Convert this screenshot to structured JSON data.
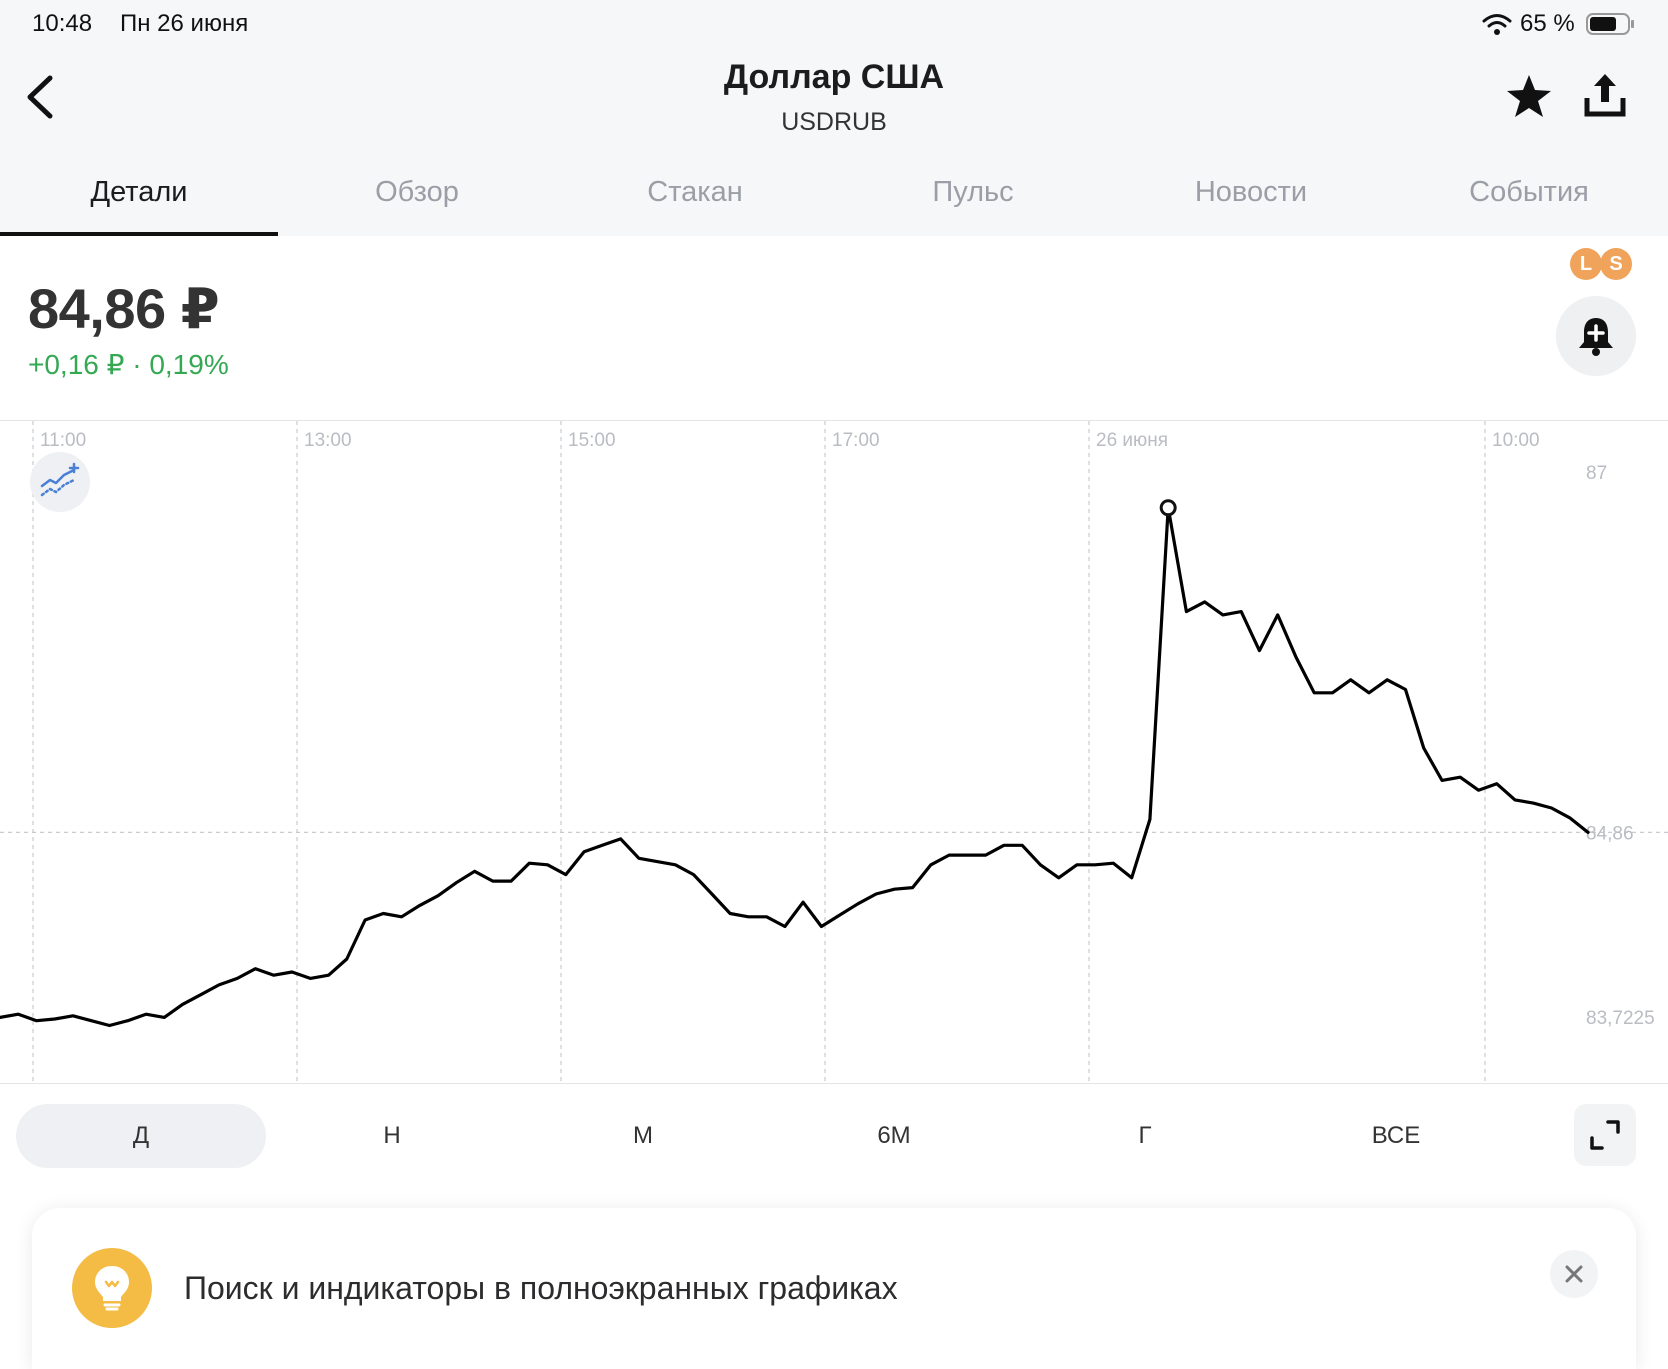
{
  "status_bar": {
    "time": "10:48",
    "date": "Пн 26 июня",
    "battery_percent": "65 %",
    "battery_level": 0.65
  },
  "header": {
    "title": "Доллар США",
    "ticker": "USDRUB"
  },
  "tabs": [
    {
      "label": "Детали",
      "active": true
    },
    {
      "label": "Обзор"
    },
    {
      "label": "Стакан"
    },
    {
      "label": "Пульс"
    },
    {
      "label": "Новости"
    },
    {
      "label": "События"
    }
  ],
  "quote": {
    "price": "84,86 ₽",
    "change": "+0,16 ₽ · 0,19%",
    "change_color": "#34a853"
  },
  "badges": {
    "l": "L",
    "s": "S",
    "color": "#f0a35a"
  },
  "icons": {
    "back": "chevron-left-icon",
    "favorite": "star-icon",
    "share": "share-upload-icon",
    "alert": "bell-plus-icon",
    "indicators": "indicators-chart-icon",
    "fullscreen": "expand-icon",
    "tip": "lightbulb-icon",
    "close": "close-icon"
  },
  "chart_data": {
    "type": "line",
    "x_ticks": [
      "11:00",
      "13:00",
      "15:00",
      "17:00",
      "26 июня",
      "10:00"
    ],
    "y_ticks": [
      "87",
      "84,86",
      "83,7225"
    ],
    "current_value": 84.86,
    "current_label": "84,86",
    "ylim": [
      83.7225,
      87.0
    ],
    "line_color": "#000000",
    "series": [
      {
        "values": [
          83.72,
          83.74,
          83.7,
          83.71,
          83.73,
          83.7,
          83.67,
          83.7,
          83.74,
          83.72,
          83.8,
          83.86,
          83.92,
          83.96,
          84.02,
          83.98,
          84.0,
          83.96,
          83.98,
          84.08,
          84.32,
          84.36,
          84.34,
          84.41,
          84.47,
          84.55,
          84.62,
          84.56,
          84.56,
          84.67,
          84.66,
          84.6,
          84.74,
          84.78,
          84.82,
          84.7,
          84.68,
          84.66,
          84.6,
          84.48,
          84.36,
          84.34,
          84.34,
          84.28,
          84.43,
          84.28,
          84.35,
          84.42,
          84.48,
          84.51,
          84.52,
          84.66,
          84.72,
          84.72,
          84.72,
          84.78,
          84.78,
          84.66,
          84.58,
          84.66,
          84.66,
          84.67,
          84.58,
          84.94,
          86.86,
          86.22,
          86.28,
          86.2,
          86.22,
          85.98,
          86.2,
          85.94,
          85.72,
          85.72,
          85.8,
          85.72,
          85.8,
          85.74,
          85.38,
          85.18,
          85.2,
          85.12,
          85.16,
          85.06,
          85.04,
          85.01,
          84.95,
          84.86
        ]
      }
    ]
  },
  "periods": [
    {
      "label": "Д",
      "active": true
    },
    {
      "label": "Н"
    },
    {
      "label": "М"
    },
    {
      "label": "6М"
    },
    {
      "label": "Г"
    },
    {
      "label": "ВСЕ"
    }
  ],
  "tip": {
    "text": "Поиск и индикаторы в полноэкранных графиках",
    "icon_color": "#f4bb45"
  }
}
